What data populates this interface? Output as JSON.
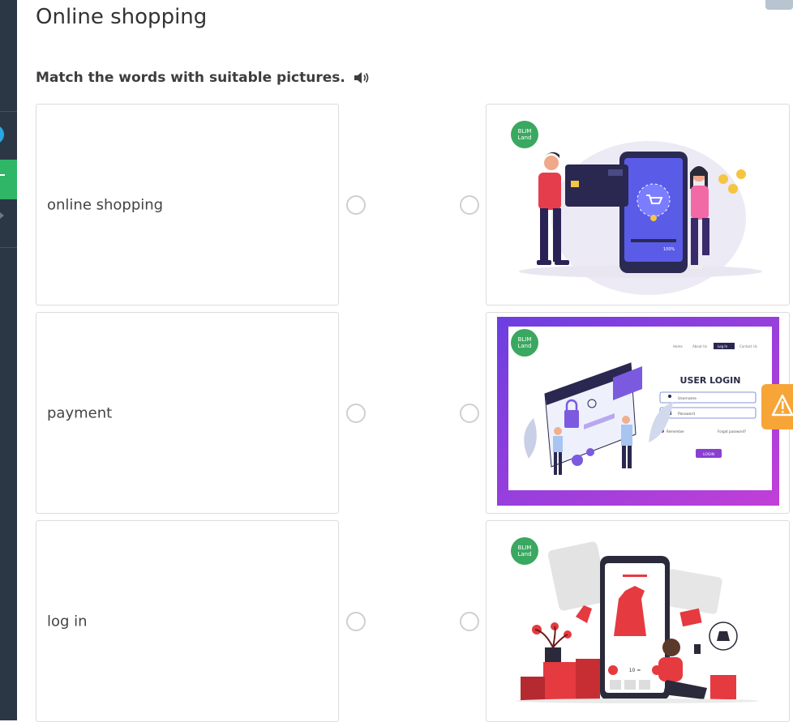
{
  "page": {
    "title": "Online shopping",
    "instruction": "Match the words with suitable pictures."
  },
  "words": [
    {
      "label": "online shopping"
    },
    {
      "label": "payment"
    },
    {
      "label": "log in"
    }
  ],
  "pictures": [
    {
      "name": "mobile-payment-illustration",
      "brand": [
        "BLIM",
        "Land"
      ],
      "screen_text": "100%"
    },
    {
      "name": "user-login-illustration",
      "brand": [
        "BLIM",
        "Land"
      ],
      "login_title": "USER LOGIN",
      "nav": [
        "Home",
        "About Us",
        "Log In",
        "Contact Us"
      ],
      "username_placeholder": "Username",
      "password_placeholder": "Password",
      "remember": "Remember",
      "forgot": "Forgot password?",
      "login_button": "LOGIN"
    },
    {
      "name": "fashion-shopping-illustration",
      "brand": [
        "BLIM",
        "Land"
      ],
      "price": "10 ="
    }
  ],
  "colors": {
    "sidebar": "#2c3746",
    "accent_green": "#2fb667",
    "accent_blue": "#29a8e0",
    "warning": "#f7a536",
    "login_purple": "#8a3fd1"
  }
}
